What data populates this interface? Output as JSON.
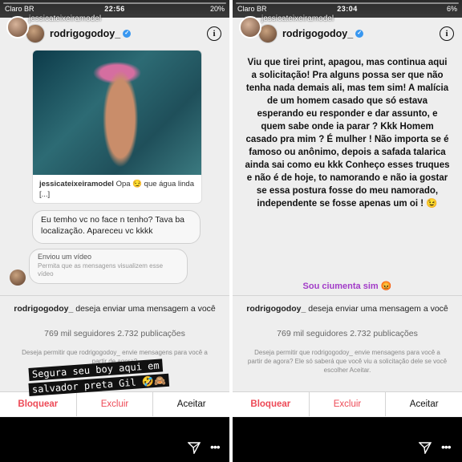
{
  "left": {
    "status": {
      "carrier": "Claro BR",
      "time": "22:56",
      "battery": "20%"
    },
    "story_user": "jessicateixeiramodel",
    "header": {
      "username": "rodrigogodoy_"
    },
    "post": {
      "caption_user": "jessicateixeiramodel",
      "caption_text": "Opa 😏 que água linda [...]"
    },
    "message_1": "Eu temho vc no face n tenho? Tava ba localização. Apareceu vc kkkk",
    "video_message": {
      "title": "Enviou um vídeo",
      "subtitle": "Permita que as mensagens visualizem esse vídeo"
    },
    "request": {
      "username": "rodrigogodoy_",
      "text": "deseja enviar uma mensagem a você"
    },
    "stats": "769 mil seguidores 2.732 publicações",
    "permit": "Deseja permitir que rodrigogodoy_ envie mensagens para você a partir de agora?",
    "overlay_lines": [
      "Segura seu boy  aqui em",
      "salvador preta Gil 🤣🙈"
    ],
    "actions": {
      "block": "Bloquear",
      "delete": "Excluir",
      "accept": "Aceitar"
    }
  },
  "right": {
    "status": {
      "carrier": "Claro BR",
      "time": "23:04",
      "battery": "6%"
    },
    "story_user": "jessicateixeiramodel",
    "header": {
      "username": "rodrigogodoy_"
    },
    "story_text": "Viu que tirei print, apagou, mas continua aqui a solicitação! Pra alguns possa ser que não tenha nada demais ali, mas tem sim! A malícia de um homem casado que só estava esperando eu responder e dar assunto, e quem sabe onde ia parar ? Kkk Homem casado pra mim ? É mulher ! Não importa se é famoso ou anônimo, depois a safada talarica ainda sai como eu kkk Conheço esses truques e não é de hoje, to namorando e não ia gostar se essa postura fosse do meu namorado, independente se fosse apenas um oi ! 😉",
    "jealous": "Sou ciumenta sim 😡",
    "request": {
      "username": "rodrigogodoy_",
      "text": "deseja enviar uma mensagem a você"
    },
    "stats": "769 mil seguidores 2.732 publicações",
    "permit": "Deseja permitir que rodrigogodoy_ envie mensagens para você a partir de agora? Ele só saberá que você viu a solicitação dele se você escolher Aceitar.",
    "actions": {
      "block": "Bloquear",
      "delete": "Excluir",
      "accept": "Aceitar"
    }
  }
}
